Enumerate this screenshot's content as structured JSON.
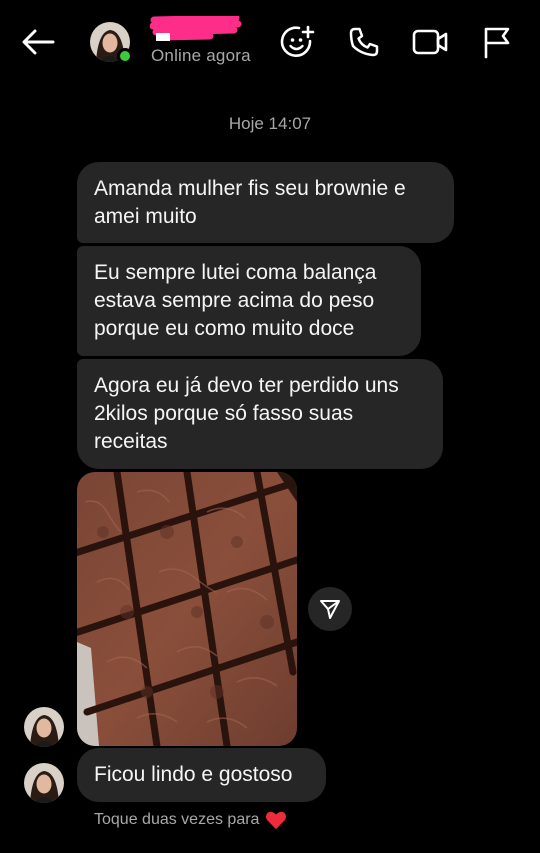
{
  "header": {
    "status": "Online agora",
    "icons": [
      "back-arrow-icon",
      "sticker-add-icon",
      "phone-icon",
      "video-camera-icon",
      "flag-icon"
    ]
  },
  "thread": {
    "timestamp": "Hoje 14:07",
    "messages": [
      {
        "text": "Amanda mulher fis seu brownie e amei muito"
      },
      {
        "text": "Eu sempre lutei coma balança estava sempre acima do peso porque eu como muito doce"
      },
      {
        "text": "Agora eu já devo ter perdido uns 2kilos porque só fasso suas receitas"
      },
      {
        "text": "Ficou lindo e gostoso"
      }
    ],
    "hint": "Toque duas vezes para"
  },
  "colors": {
    "background": "#000000",
    "bubble": "#262626",
    "online": "#3ec93a",
    "redaction": "#ff2d8a",
    "heart": "#ed2b3b"
  }
}
